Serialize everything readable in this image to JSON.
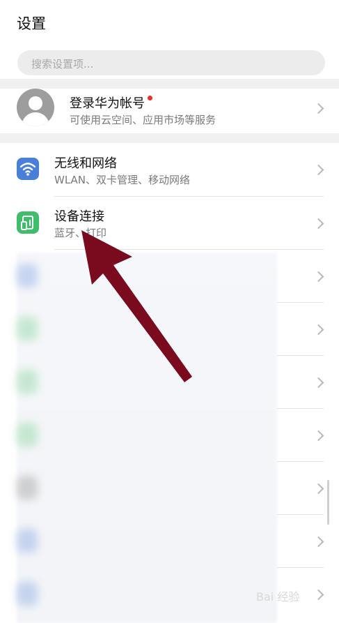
{
  "header": {
    "title": "设置"
  },
  "search": {
    "placeholder": "搜索设置项..."
  },
  "account": {
    "title": "登录华为帐号",
    "subtitle": "可使用云空间、应用市场等服务"
  },
  "items": [
    {
      "title": "无线和网络",
      "subtitle": "WLAN、双卡管理、移动网络",
      "icon": "wifi-icon",
      "color": "#4a7fd8"
    },
    {
      "title": "设备连接",
      "subtitle": "蓝牙、打印",
      "icon": "device-connect-icon",
      "color": "#3fbd6b"
    }
  ],
  "annotation": {
    "color": "#7a0a1e"
  },
  "watermark": {
    "text": "Bai 经验"
  }
}
